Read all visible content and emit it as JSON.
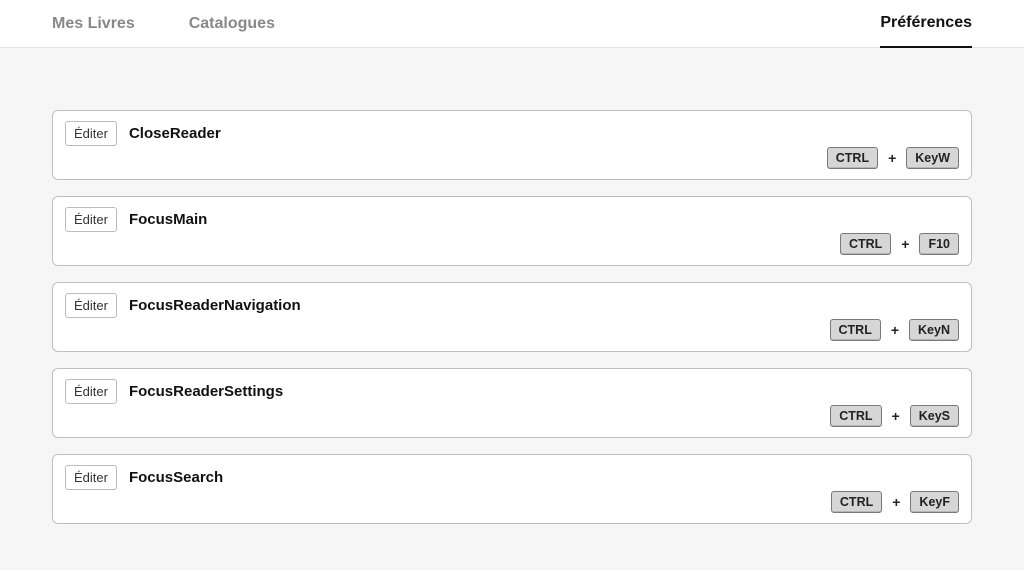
{
  "nav": {
    "my_books": "Mes Livres",
    "catalogs": "Catalogues",
    "preferences": "Préférences"
  },
  "edit_label": "Éditer",
  "plus": "+",
  "shortcuts": [
    {
      "name": "CloseReader",
      "keys": [
        "CTRL",
        "KeyW"
      ]
    },
    {
      "name": "FocusMain",
      "keys": [
        "CTRL",
        "F10"
      ]
    },
    {
      "name": "FocusReaderNavigation",
      "keys": [
        "CTRL",
        "KeyN"
      ]
    },
    {
      "name": "FocusReaderSettings",
      "keys": [
        "CTRL",
        "KeyS"
      ]
    },
    {
      "name": "FocusSearch",
      "keys": [
        "CTRL",
        "KeyF"
      ]
    }
  ]
}
